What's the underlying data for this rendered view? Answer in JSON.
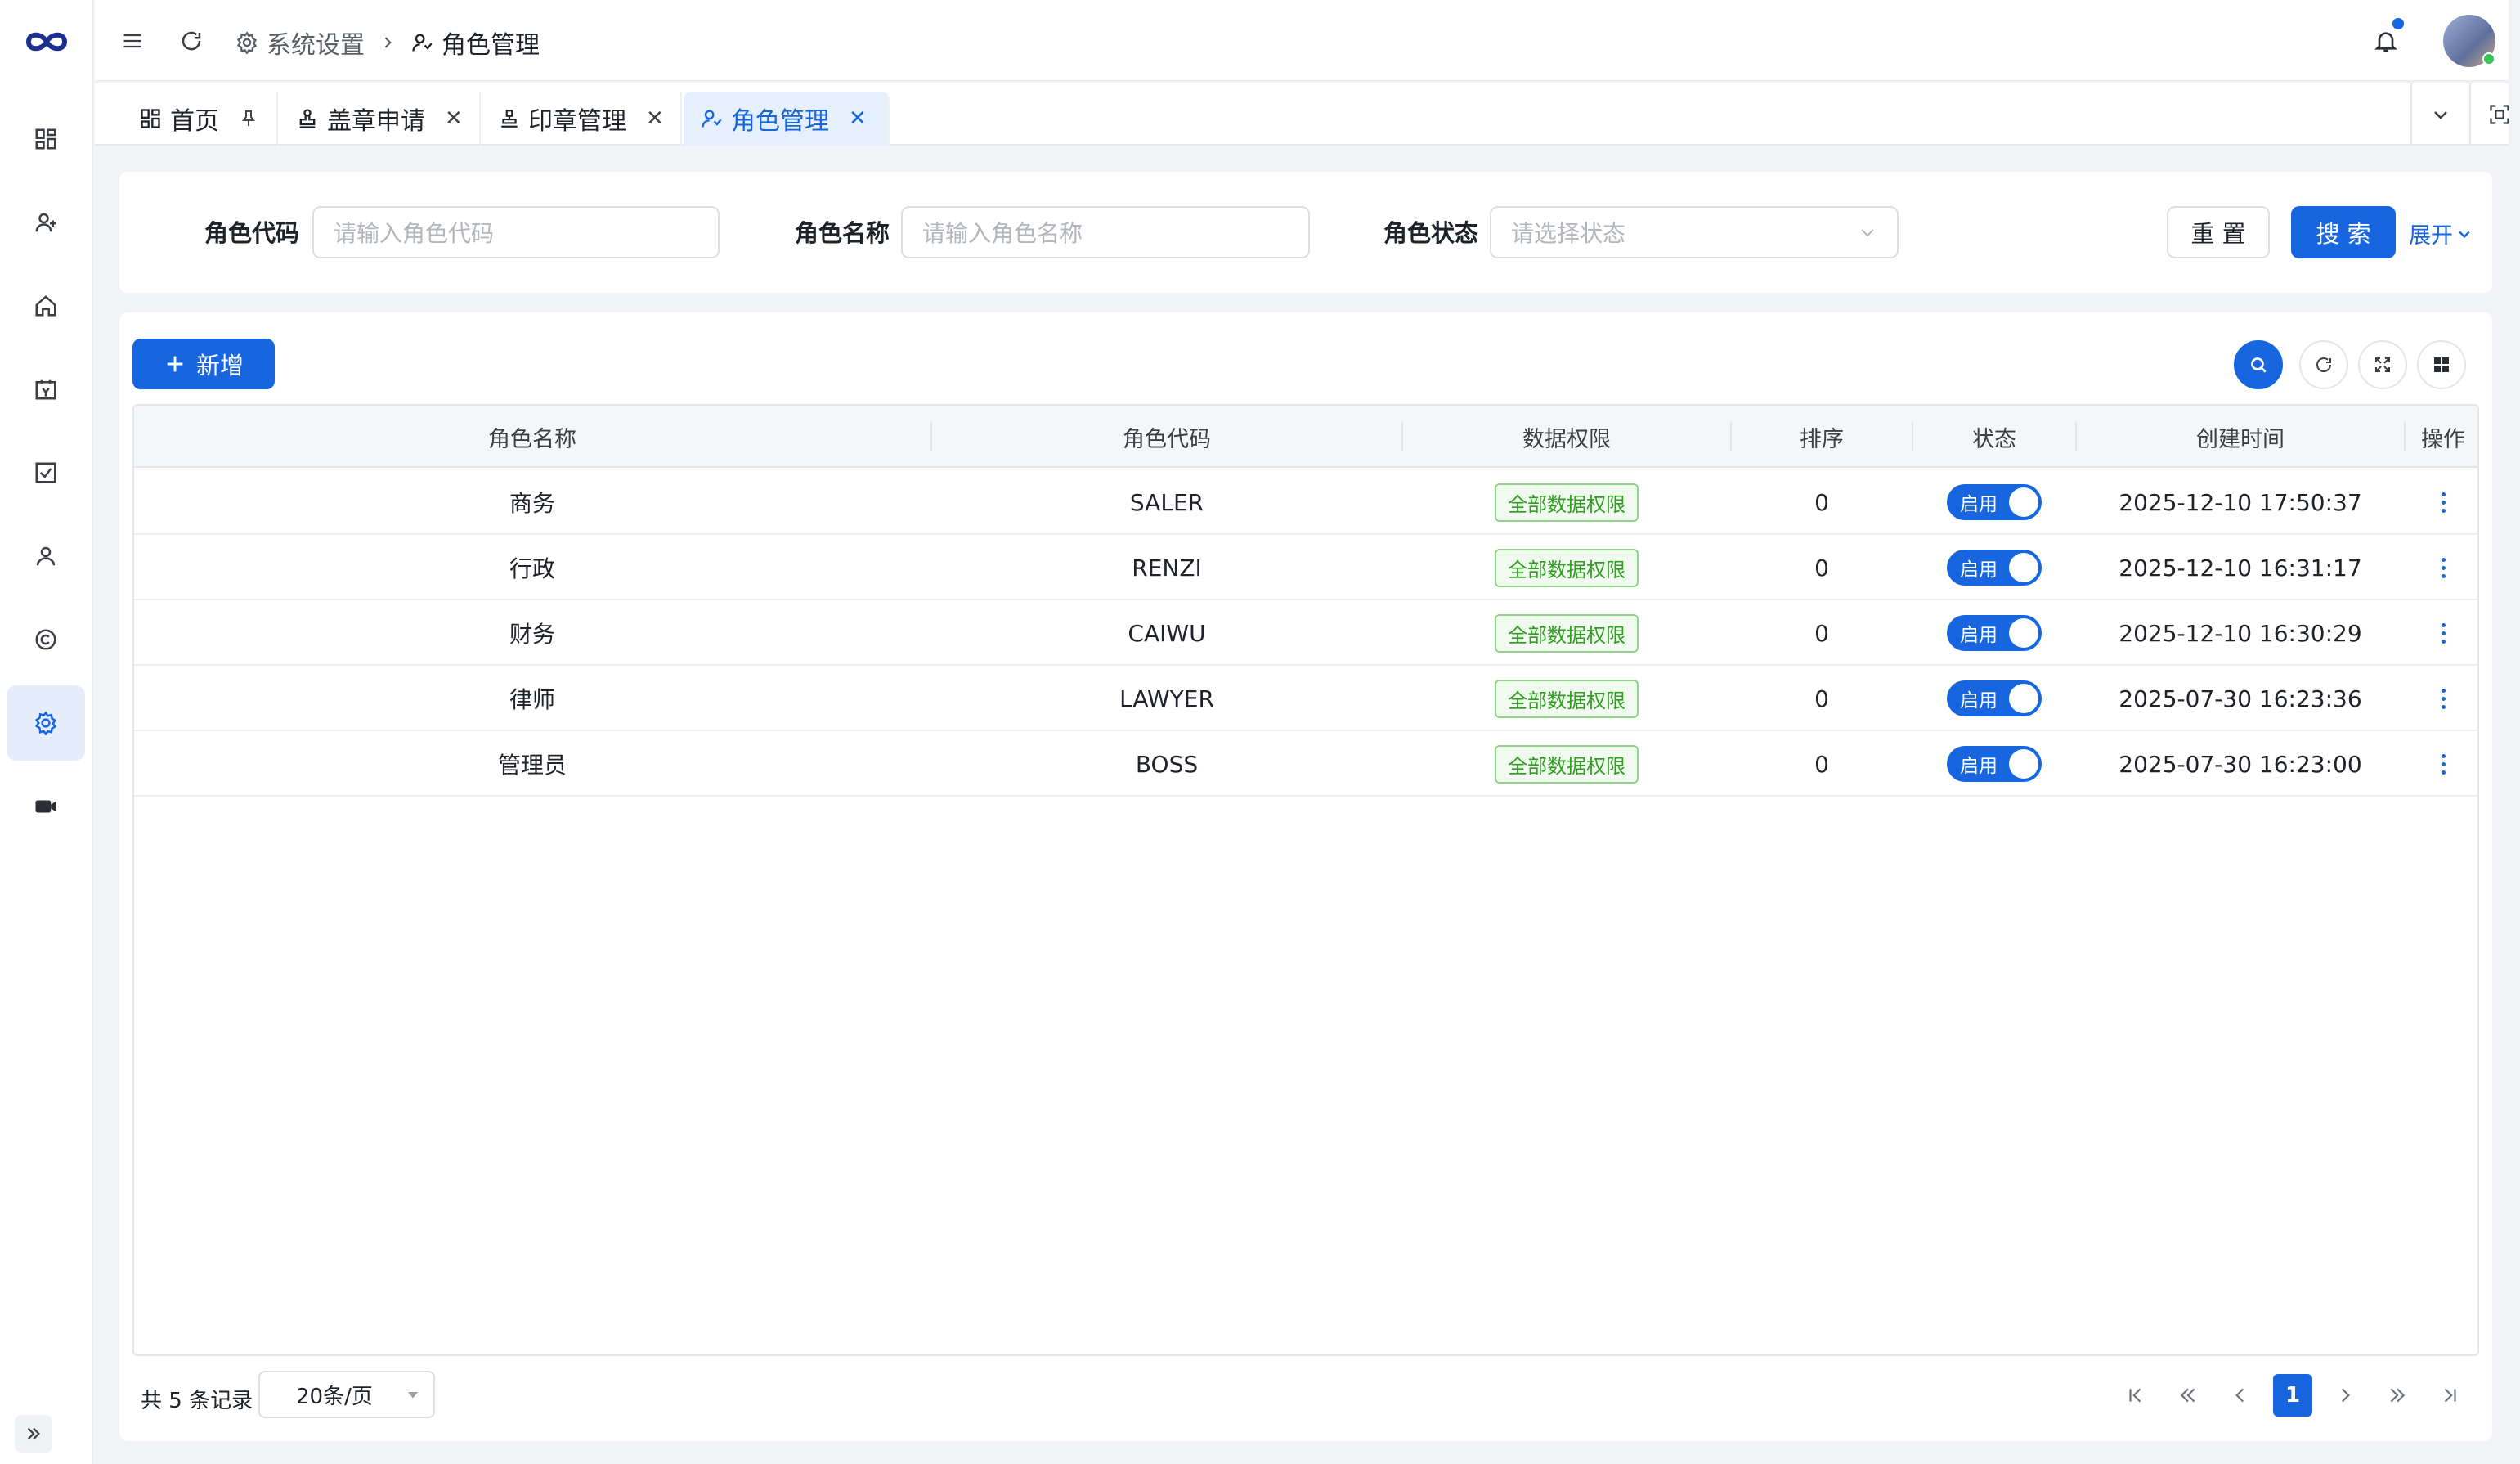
{
  "breadcrumb": {
    "parent": "系统设置",
    "current": "角色管理"
  },
  "tabs": [
    {
      "label": "首页",
      "icon": "dashboard-icon",
      "action": "pin-icon"
    },
    {
      "label": "盖章申请",
      "icon": "stamp-icon",
      "action": "close-icon"
    },
    {
      "label": "印章管理",
      "icon": "seal-icon",
      "action": "close-icon"
    },
    {
      "label": "角色管理",
      "icon": "role-icon",
      "action": "close-icon",
      "active": true
    }
  ],
  "filter": {
    "code_label": "角色代码",
    "code_placeholder": "请输入角色代码",
    "name_label": "角色名称",
    "name_placeholder": "请输入角色名称",
    "status_label": "角色状态",
    "status_placeholder": "请选择状态",
    "reset": "重 置",
    "search": "搜 索",
    "expand": "展开"
  },
  "toolbar": {
    "add": "新增"
  },
  "table": {
    "columns": [
      "角色名称",
      "角色代码",
      "数据权限",
      "排序",
      "状态",
      "创建时间",
      "操作"
    ],
    "rows": [
      {
        "name": "商务",
        "code": "SALER",
        "scope": "全部数据权限",
        "sort": "0",
        "status": "启用",
        "created": "2025-12-10 17:50:37"
      },
      {
        "name": "行政",
        "code": "RENZI",
        "scope": "全部数据权限",
        "sort": "0",
        "status": "启用",
        "created": "2025-12-10 16:31:17"
      },
      {
        "name": "财务",
        "code": "CAIWU",
        "scope": "全部数据权限",
        "sort": "0",
        "status": "启用",
        "created": "2025-12-10 16:30:29"
      },
      {
        "name": "律师",
        "code": "LAWYER",
        "scope": "全部数据权限",
        "sort": "0",
        "status": "启用",
        "created": "2025-07-30 16:23:36"
      },
      {
        "name": "管理员",
        "code": "BOSS",
        "scope": "全部数据权限",
        "sort": "0",
        "status": "启用",
        "created": "2025-07-30 16:23:00"
      }
    ]
  },
  "footer": {
    "total": "共 5 条记录",
    "page_size": "20条/页",
    "current_page": "1"
  },
  "colors": {
    "primary": "#1766e0",
    "tag_green": "#2f9e1f"
  }
}
